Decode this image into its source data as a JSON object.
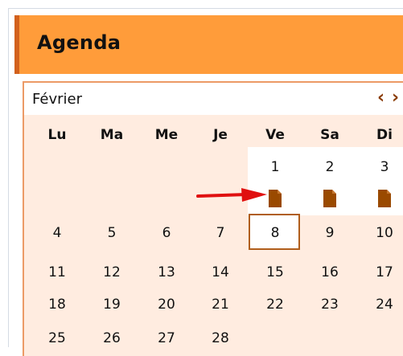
{
  "agenda": {
    "title": "Agenda",
    "month": "Février",
    "nav_prev": "‹",
    "nav_next": "›",
    "weekdays": [
      "Lu",
      "Ma",
      "Me",
      "Je",
      "Ve",
      "Sa",
      "Di"
    ],
    "days": [
      "1",
      "2",
      "3",
      "4",
      "5",
      "6",
      "7",
      "8",
      "9",
      "10",
      "11",
      "12",
      "13",
      "14",
      "15",
      "16",
      "17",
      "18",
      "19",
      "20",
      "21",
      "22",
      "23",
      "24",
      "25",
      "26",
      "27",
      "28"
    ],
    "today": "8",
    "event_days": [
      "1",
      "2",
      "3"
    ],
    "icons": {
      "event": "document-icon",
      "pointer": "red-arrow-icon"
    },
    "colors": {
      "header_bg": "#ff9c3a",
      "header_accent": "#d2611d",
      "calendar_bg": "#ffece0",
      "event_icon": "#9a4a00",
      "arrow": "#e01010"
    }
  }
}
